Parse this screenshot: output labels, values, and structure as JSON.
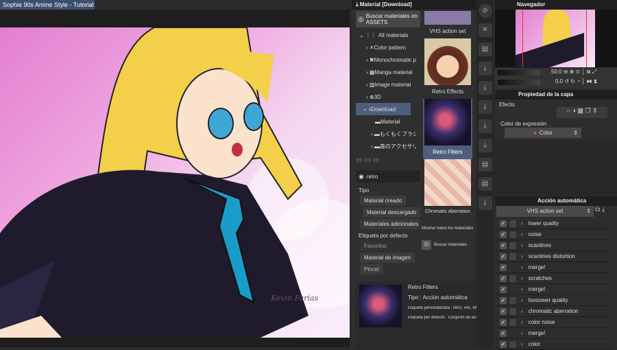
{
  "document": {
    "tab_title": "Sophie 90s Anime Style - Tutorial",
    "watermark": "Kevin Farias"
  },
  "material_panel": {
    "title": "Material [Download]",
    "search_assets_label": "Buscar materiales en ASSETS",
    "tree": [
      {
        "label": "All materials",
        "icon": "grid-icon"
      },
      {
        "label": "Color pattern",
        "icon": "pattern-icon"
      },
      {
        "label": "Monochromatic pattern",
        "icon": "pattern-icon"
      },
      {
        "label": "Manga material",
        "icon": "manga-icon"
      },
      {
        "label": "Image material",
        "icon": "image-icon"
      },
      {
        "label": "3D",
        "icon": "globe-icon"
      },
      {
        "label": "Download",
        "icon": "download-folder-icon",
        "selected": true
      },
      {
        "label": "Material",
        "icon": "folder-icon"
      },
      {
        "label": "もくもくブラシ",
        "icon": "folder-icon"
      },
      {
        "label": "森のアクセサリー",
        "icon": "folder-icon"
      }
    ],
    "search_value": "retro",
    "filter_type_label": "Tipo",
    "type_chips": [
      "Material creado",
      "Material descargado",
      "Materiales adicionales"
    ],
    "default_tag_label": "Etiqueta por defecto",
    "tag_chips": [
      "Favoritos",
      "Material de imagen",
      "Pincel"
    ],
    "thumbnails": [
      {
        "label": "VHS action set"
      },
      {
        "label": "Retro Effects"
      },
      {
        "label": "Retro Filters",
        "selected": true
      },
      {
        "label": "Chromatic Aberration"
      }
    ],
    "show_all_label": "Mostrar todos los materiales",
    "search_more_label": "Buscar materiales",
    "detail": {
      "name": "Retro Filters",
      "type": "Tipo : Acción automática",
      "custom_tags": "Etiqueta personalizada : retro, vhs, filter",
      "default_tags": "Etiqueta por defecto : Conjunto de acciones"
    }
  },
  "navigator": {
    "title": "Navegador",
    "zoom": "50.0",
    "rotation": "0.0"
  },
  "layer_property": {
    "title": "Propiedad de la capa",
    "effect_label": "Efecto",
    "expression_color_label": "Color de expresión",
    "expression_color_value": "Color"
  },
  "auto_action": {
    "title": "Acción automática",
    "set_name": "VHS action set",
    "actions": [
      {
        "label": "lower quality",
        "dialog": true
      },
      {
        "label": "noise",
        "dialog": true
      },
      {
        "label": "scanlines",
        "dialog": true
      },
      {
        "label": "scanlines distortion",
        "dialog": true
      },
      {
        "label": "merge!",
        "dialog": false
      },
      {
        "label": "scratches",
        "dialog": true
      },
      {
        "label": "merge!",
        "dialog": false
      },
      {
        "label": "loooower quality",
        "dialog": true
      },
      {
        "label": "chromatic aberration",
        "dialog": true
      },
      {
        "label": "color noise",
        "dialog": true
      },
      {
        "label": "merge!",
        "dialog": false
      },
      {
        "label": "color",
        "dialog": true
      }
    ]
  }
}
